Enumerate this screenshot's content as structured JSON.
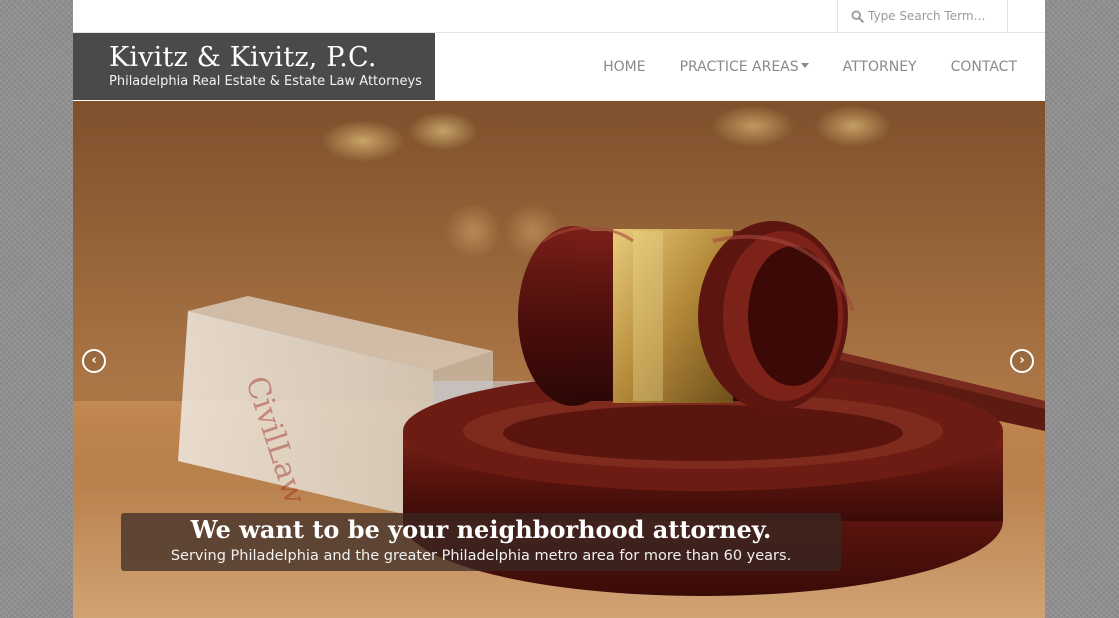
{
  "search": {
    "placeholder": "Type Search Term…",
    "icon": "search-icon"
  },
  "branding": {
    "title": "Kivitz & Kivitz, P.C.",
    "subtitle": "Philadelphia Real Estate & Estate Law Attorneys"
  },
  "nav": {
    "items": [
      {
        "label": "HOME"
      },
      {
        "label": "PRACTICE AREAS",
        "has_dropdown": true
      },
      {
        "label": "ATTORNEY"
      },
      {
        "label": "CONTACT"
      }
    ]
  },
  "hero": {
    "image": "gavel-and-law-book-photo",
    "caption_title": "We want to be your neighborhood attorney.",
    "caption_subtitle": "Serving Philadelphia and the greater Philadelphia metro area for more than 60 years.",
    "prev_icon": "chevron-left-icon",
    "next_icon": "chevron-right-icon"
  },
  "colors": {
    "logo_bg": "#4a4a4a",
    "nav_text": "#8a8a8a",
    "page_bg": "#8f8f8f"
  }
}
